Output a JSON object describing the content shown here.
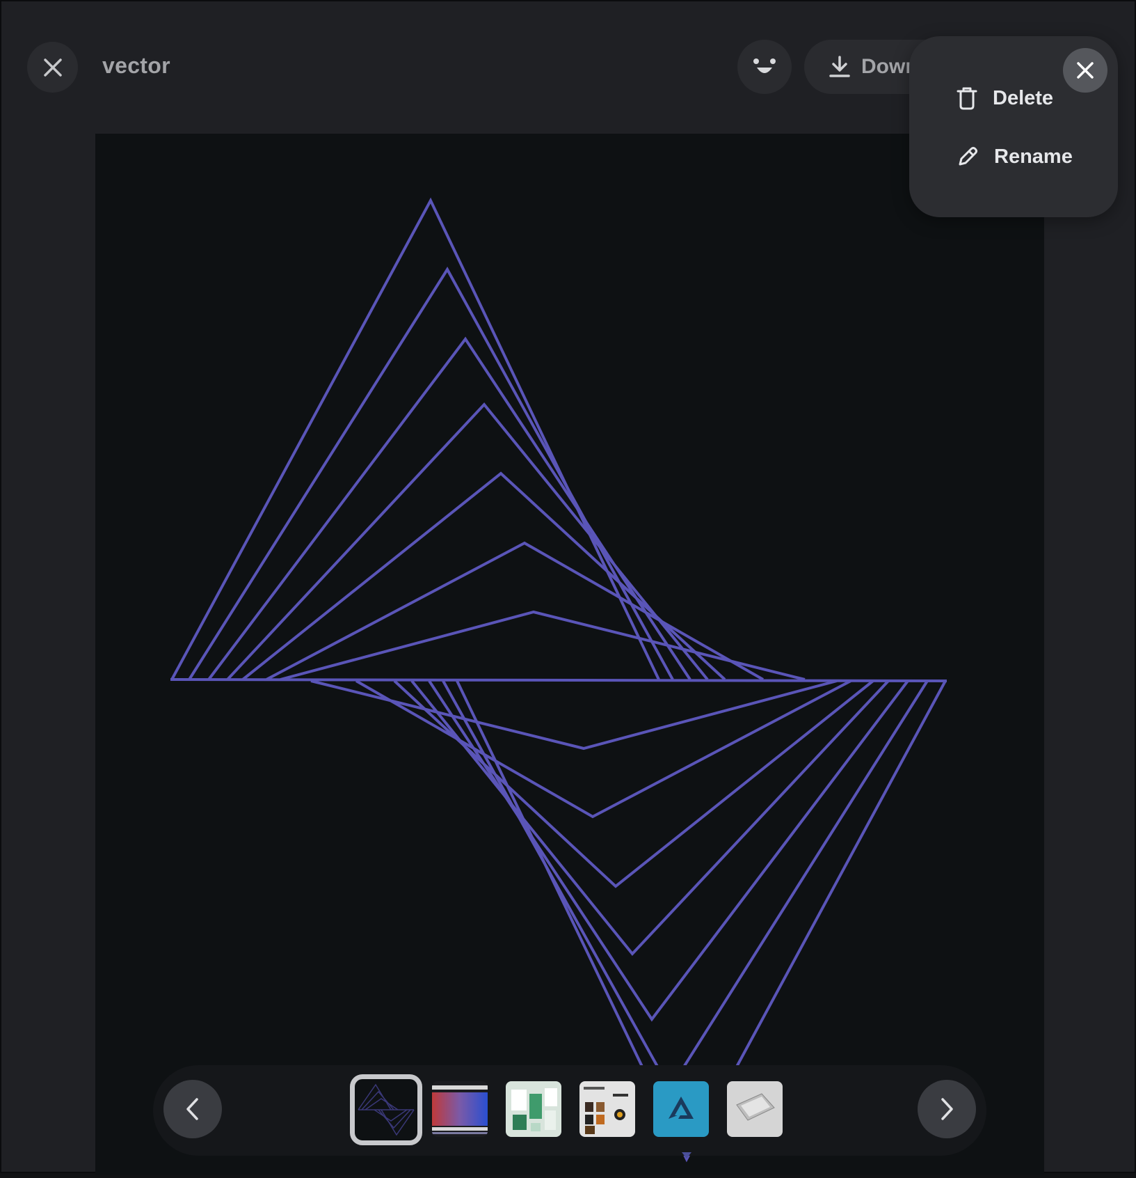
{
  "header": {
    "title": "vector",
    "download_label": "Down"
  },
  "context_menu": {
    "items": [
      {
        "label": "Delete",
        "icon": "trash-icon"
      },
      {
        "label": "Rename",
        "icon": "pencil-icon"
      }
    ]
  },
  "colors": {
    "line": "#5a55b8",
    "canvas": "#0e1113",
    "viewer": "#1f2024"
  },
  "filmstrip": {
    "thumbnails": [
      {
        "name": "vector",
        "selected": true
      },
      {
        "name": "gradient-bars",
        "selected": false
      },
      {
        "name": "green-app-mockup",
        "selected": false
      },
      {
        "name": "dashboard-mockup",
        "selected": false
      },
      {
        "name": "blue-triangle-logo",
        "selected": false
      },
      {
        "name": "phone-mockup",
        "selected": false
      }
    ]
  }
}
